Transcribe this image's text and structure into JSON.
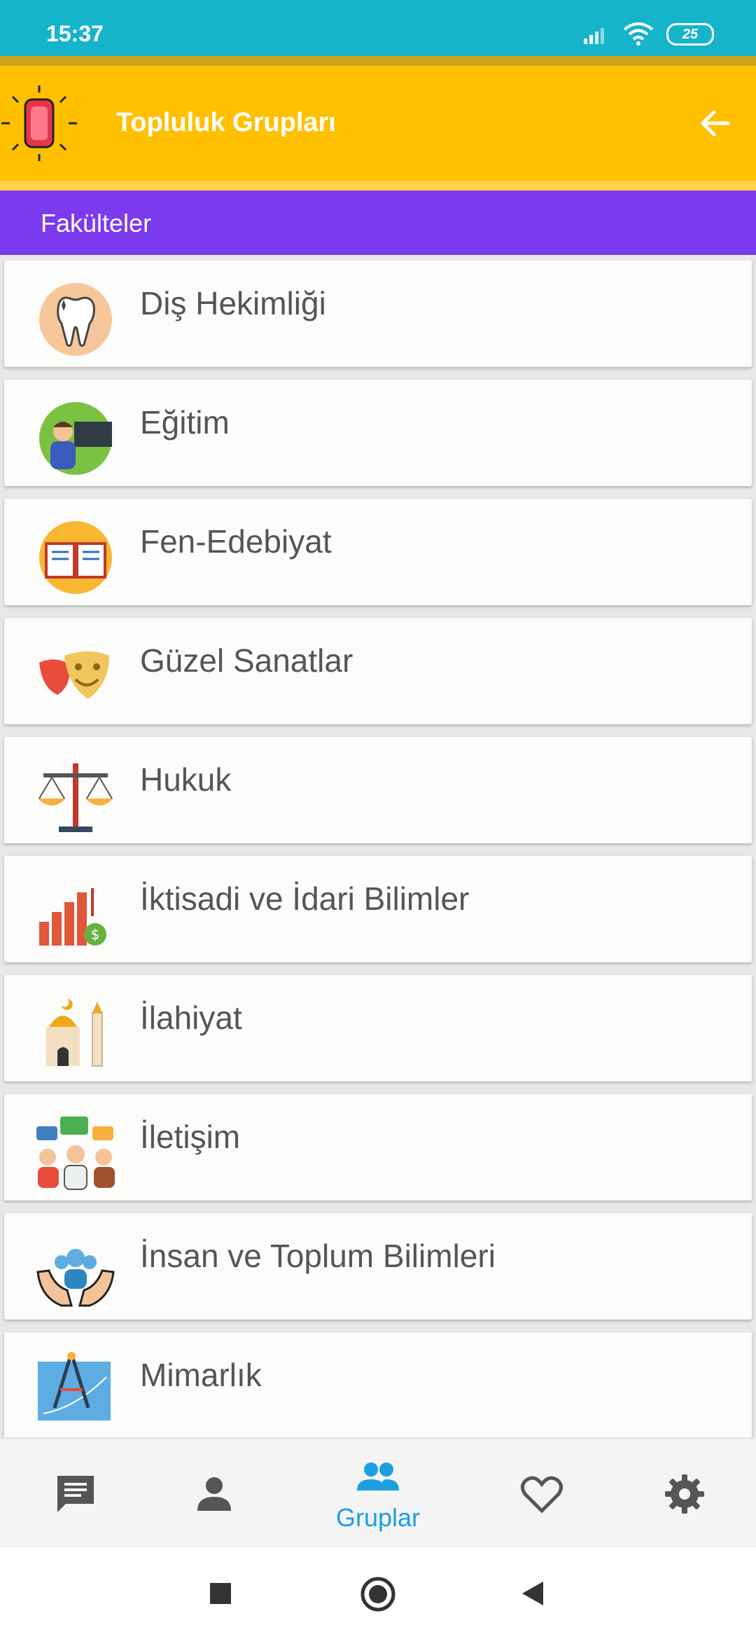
{
  "status_bar": {
    "time": "15:37",
    "battery": "25"
  },
  "app_bar": {
    "title": "Topluluk Grupları"
  },
  "section": {
    "title": "Fakülteler"
  },
  "faculties": [
    {
      "label": "Diş Hekimliği",
      "icon": "tooth-icon"
    },
    {
      "label": "Eğitim",
      "icon": "teacher-icon"
    },
    {
      "label": "Fen-Edebiyat",
      "icon": "open-book-icon"
    },
    {
      "label": "Güzel Sanatlar",
      "icon": "theater-masks-icon"
    },
    {
      "label": "Hukuk",
      "icon": "scales-icon"
    },
    {
      "label": "İktisadi ve İdari Bilimler",
      "icon": "bar-chart-money-icon"
    },
    {
      "label": "İlahiyat",
      "icon": "mosque-icon"
    },
    {
      "label": "İletişim",
      "icon": "people-chat-icon"
    },
    {
      "label": "İnsan ve Toplum Bilimleri",
      "icon": "community-hands-icon"
    },
    {
      "label": "Mimarlık",
      "icon": "blueprint-compass-icon"
    }
  ],
  "bottom_nav": {
    "active_label": "Gruplar",
    "items": [
      "chat-icon",
      "person-icon",
      "groups-icon",
      "heart-icon",
      "settings-icon"
    ]
  },
  "colors": {
    "status": "#16b4cb",
    "app_bar": "#ffc000",
    "section": "#7b3aed",
    "accent": "#1b9fe0"
  }
}
